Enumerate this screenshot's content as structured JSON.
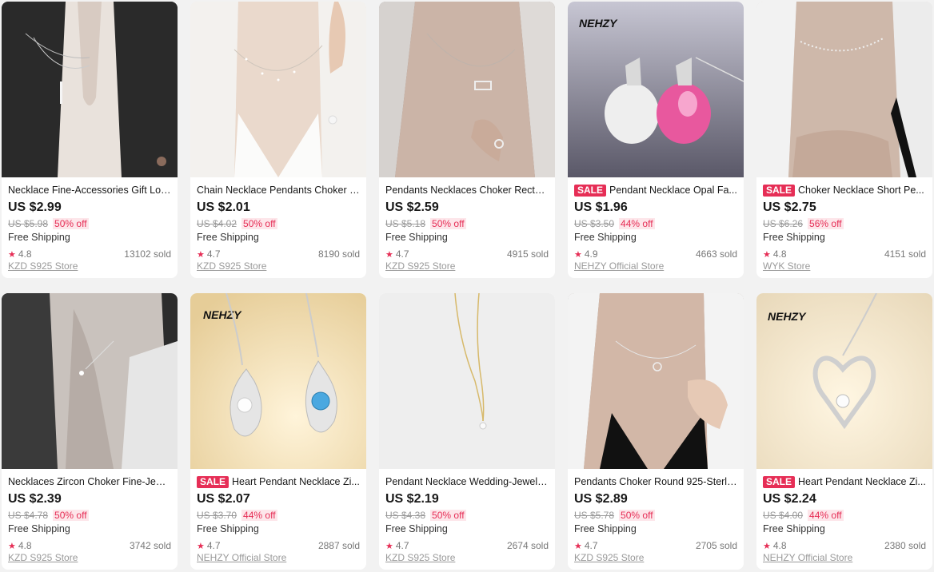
{
  "colors": {
    "sale_badge": "#e62e56",
    "discount_bg": "#fde6ea",
    "star": "#e62e56"
  },
  "products": [
    {
      "title": "Necklace Fine-Accessories Gift Lon...",
      "sale": false,
      "price": "US $2.99",
      "original": "US $5.98",
      "discount": "50% off",
      "shipping": "Free Shipping",
      "rating": "4.8",
      "sold": "13102 sold",
      "store": "KZD S925 Store",
      "image": "woman-black-blazer-bar-necklace"
    },
    {
      "title": "Chain Necklace Pendants Choker F...",
      "sale": false,
      "price": "US $2.01",
      "original": "US $4.02",
      "discount": "50% off",
      "shipping": "Free Shipping",
      "rating": "4.7",
      "sold": "8190 sold",
      "store": "KZD S925 Store",
      "image": "woman-white-shirt-chain"
    },
    {
      "title": "Pendants Necklaces Choker Recta...",
      "sale": false,
      "price": "US $2.59",
      "original": "US $5.18",
      "discount": "50% off",
      "shipping": "Free Shipping",
      "rating": "4.7",
      "sold": "4915 sold",
      "store": "KZD S925 Store",
      "image": "woman-rectangle-pendant"
    },
    {
      "title": "Pendant Necklace Opal Fa...",
      "sale": true,
      "sale_label": "SALE",
      "price": "US $1.96",
      "original": "US $3.50",
      "discount": "44% off",
      "shipping": "Free Shipping",
      "rating": "4.9",
      "sold": "4663 sold",
      "store": "NEHZY Official Store",
      "image": "opal-apple-pendants",
      "brand": "NEHZY"
    },
    {
      "title": "Choker Necklace Short Pe...",
      "sale": true,
      "sale_label": "SALE",
      "price": "US $2.75",
      "original": "US $6.26",
      "discount": "56% off",
      "shipping": "Free Shipping",
      "rating": "4.8",
      "sold": "4151 sold",
      "store": "WYK Store",
      "image": "woman-short-choker"
    },
    {
      "title": "Necklaces Zircon Choker Fine-Jewe...",
      "sale": false,
      "price": "US $2.39",
      "original": "US $4.78",
      "discount": "50% off",
      "shipping": "Free Shipping",
      "rating": "4.8",
      "sold": "3742 sold",
      "store": "KZD S925 Store",
      "image": "woman-zircon-choker"
    },
    {
      "title": "Heart Pendant Necklace Zi...",
      "sale": true,
      "sale_label": "SALE",
      "price": "US $2.07",
      "original": "US $3.70",
      "discount": "44% off",
      "shipping": "Free Shipping",
      "rating": "4.7",
      "sold": "2887 sold",
      "store": "NEHZY Official Store",
      "image": "twin-flame-pendants",
      "brand": "NEHZY"
    },
    {
      "title": "Pendant Necklace Wedding-Jewelr...",
      "sale": false,
      "price": "US $2.19",
      "original": "US $4.38",
      "discount": "50% off",
      "shipping": "Free Shipping",
      "rating": "4.7",
      "sold": "2674 sold",
      "store": "KZD S925 Store",
      "image": "gold-chain-solitaire"
    },
    {
      "title": "Pendants Choker Round 925-Sterli...",
      "sale": false,
      "price": "US $2.89",
      "original": "US $5.78",
      "discount": "50% off",
      "shipping": "Free Shipping",
      "rating": "4.7",
      "sold": "2705 sold",
      "store": "KZD S925 Store",
      "image": "woman-round-choker"
    },
    {
      "title": "Heart Pendant Necklace Zi...",
      "sale": true,
      "sale_label": "SALE",
      "price": "US $2.24",
      "original": "US $4.00",
      "discount": "44% off",
      "shipping": "Free Shipping",
      "rating": "4.8",
      "sold": "2380 sold",
      "store": "NEHZY Official Store",
      "image": "heart-pendant",
      "brand": "NEHZY"
    }
  ]
}
